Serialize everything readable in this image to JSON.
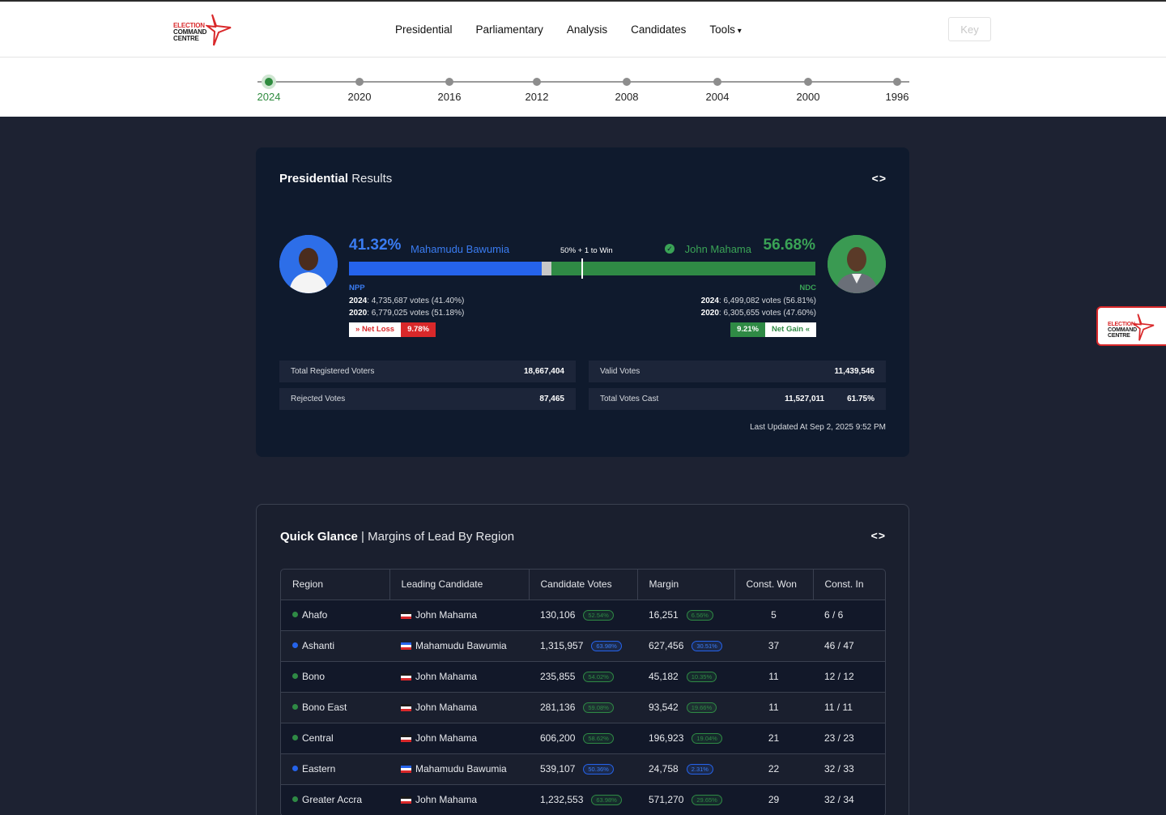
{
  "header": {
    "logo_lines": [
      "ELECTION",
      "COMMAND",
      "CENTRE"
    ],
    "nav": [
      "Presidential",
      "Parliamentary",
      "Analysis",
      "Candidates",
      "Tools"
    ],
    "key_label": "Key"
  },
  "timeline": {
    "years": [
      "2024",
      "2020",
      "2016",
      "2012",
      "2008",
      "2004",
      "2000",
      "1996"
    ],
    "active": "2024"
  },
  "presidential": {
    "title_bold": "Presidential",
    "title_rest": "Results",
    "code_icon": "<>",
    "left": {
      "pct": "41.32%",
      "name": "Mahamudu Bawumia",
      "party": "NPP",
      "y2024_label": "2024",
      "y2024": ": 4,735,687 votes (41.40%)",
      "y2020_label": "2020",
      "y2020": ": 6,779,025 votes (51.18%)",
      "chip_word": "Net Loss",
      "chip_value": "9.78%",
      "chip_icon": "double-chevron-down-icon"
    },
    "right": {
      "pct": "56.68%",
      "name": "John Mahama",
      "party": "NDC",
      "y2024_label": "2024",
      "y2024": ": 6,499,082 votes (56.81%)",
      "y2020_label": "2020",
      "y2020": ": 6,305,655 votes (47.60%)",
      "chip_word": "Net Gain",
      "chip_value": "9.21%",
      "chip_icon": "double-chevron-up-icon"
    },
    "win_label": "50% + 1 to Win",
    "bar": {
      "npp_share": 41.32,
      "other_share": 2.0,
      "ndc_share": 56.68
    },
    "stats": {
      "registered_label": "Total Registered Voters",
      "registered": "18,667,404",
      "valid_label": "Valid Votes",
      "valid": "11,439,546",
      "rejected_label": "Rejected Votes",
      "rejected": "87,465",
      "cast_label": "Total Votes Cast",
      "cast": "11,527,011",
      "turnout": "61.75%"
    },
    "updated": "Last Updated At Sep 2, 2025 9:52 PM"
  },
  "glance": {
    "title_bold": "Quick Glance",
    "title_rest": " | Margins of Lead By Region",
    "code_icon": "<>",
    "columns": [
      "Region",
      "Leading Candidate",
      "Candidate Votes",
      "Margin",
      "Const. Won",
      "Const. In"
    ],
    "rows": [
      {
        "region": "Ahafo",
        "party": "ndc",
        "candidate": "John Mahama",
        "votes": "130,106",
        "votes_pct": "52.54%",
        "margin": "16,251",
        "margin_pct": "6.56%",
        "won": "5",
        "in": "6 / 6"
      },
      {
        "region": "Ashanti",
        "party": "npp",
        "candidate": "Mahamudu Bawumia",
        "votes": "1,315,957",
        "votes_pct": "63.98%",
        "margin": "627,456",
        "margin_pct": "30.51%",
        "won": "37",
        "in": "46 / 47"
      },
      {
        "region": "Bono",
        "party": "ndc",
        "candidate": "John Mahama",
        "votes": "235,855",
        "votes_pct": "54.02%",
        "margin": "45,182",
        "margin_pct": "10.35%",
        "won": "11",
        "in": "12 / 12"
      },
      {
        "region": "Bono East",
        "party": "ndc",
        "candidate": "John Mahama",
        "votes": "281,136",
        "votes_pct": "59.08%",
        "margin": "93,542",
        "margin_pct": "19.66%",
        "won": "11",
        "in": "11 / 11"
      },
      {
        "region": "Central",
        "party": "ndc",
        "candidate": "John Mahama",
        "votes": "606,200",
        "votes_pct": "58.62%",
        "margin": "196,923",
        "margin_pct": "19.04%",
        "won": "21",
        "in": "23 / 23"
      },
      {
        "region": "Eastern",
        "party": "npp",
        "candidate": "Mahamudu Bawumia",
        "votes": "539,107",
        "votes_pct": "50.36%",
        "margin": "24,758",
        "margin_pct": "2.31%",
        "won": "22",
        "in": "32 / 33"
      },
      {
        "region": "Greater Accra",
        "party": "ndc",
        "candidate": "John Mahama",
        "votes": "1,232,553",
        "votes_pct": "63.98%",
        "margin": "571,270",
        "margin_pct": "29.65%",
        "won": "29",
        "in": "32 / 34"
      }
    ]
  },
  "colors": {
    "npp": "#2563eb",
    "ndc": "#2f8a45",
    "accent_red": "#d9282a"
  }
}
